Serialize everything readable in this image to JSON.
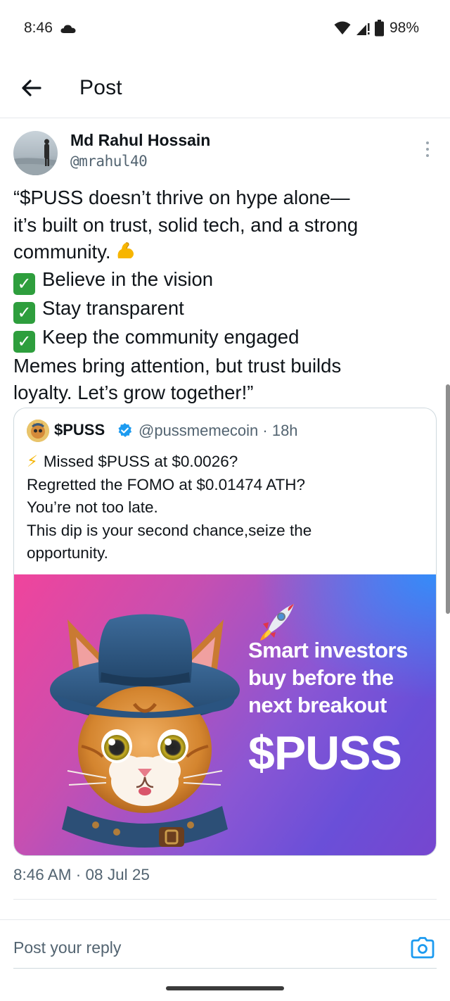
{
  "status_bar": {
    "time": "8:46",
    "battery": "98%"
  },
  "header": {
    "title": "Post"
  },
  "author": {
    "name": "Md Rahul Hossain",
    "handle": "@mrahul40"
  },
  "tweet": {
    "lines": [
      "“$PUSS doesn’t thrive on hype alone—",
      "it’s built on trust, solid tech, and a strong",
      "community.",
      "Believe in the vision",
      "Stay transparent",
      "Keep the community engaged",
      "Memes bring attention, but trust builds",
      "loyalty. Let’s grow together!”"
    ]
  },
  "quote": {
    "name": "$PUSS",
    "handle_time": "@pussmemecoin · 18h",
    "lines": [
      "Missed $PUSS at $0.0026?",
      "Regretted the FOMO at $0.01474 ATH?",
      "You’re not too late.",
      "This dip is your second chance,seize the",
      "opportunity."
    ],
    "image": {
      "lines": [
        "Smart investors",
        "buy before the",
        "next breakout"
      ],
      "brand": "$PUSS"
    }
  },
  "timestamp": "8:46 AM · 08 Jul 25",
  "reply": {
    "placeholder": "Post your reply"
  },
  "colors": {
    "accent": "#1d9bf0",
    "text": "#0f1419",
    "muted": "#536471"
  }
}
